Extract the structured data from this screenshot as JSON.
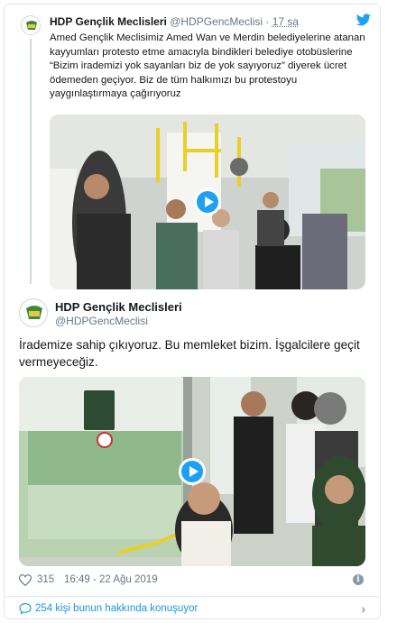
{
  "colors": {
    "accent": "#1da1f2",
    "link": "#1b95e0",
    "muted": "#657786",
    "border": "#e1e8ed"
  },
  "parent_tweet": {
    "name": "HDP Gençlik Meclisleri",
    "handle": "@HDPGencMeclisi",
    "separator": "·",
    "time": "17 sa",
    "text": "Amed Gençlik Meclisimiz Amed Wan ve Merdin belediyelerine atanan kayyumları protesto etme amacıyla bindikleri belediye otobüslerine “Bizim irademizi yok sayanları biz de yok sayıyoruz” diyerek ücret ödemeden geçiyor. Biz de tüm halkımızı bu protestoyu yaygınlaştırmaya çağırıyoruz",
    "media": "video"
  },
  "main_tweet": {
    "name": "HDP Gençlik Meclisleri",
    "handle": "@HDPGencMeclisi",
    "text": "İrademize sahip çıkıyoruz. Bu memleket bizim. İşgalcilere geçit vermeyeceğiz.",
    "media": "video",
    "likes": "315",
    "timestamp": "16:49 - 22 Ağu 2019"
  },
  "conversation": {
    "label": "254 kişi bunun hakkında konuşuyor"
  },
  "icons": [
    "twitter-bird-icon",
    "play-icon",
    "heart-icon",
    "info-icon",
    "comment-bubble-icon",
    "chevron-right-icon"
  ]
}
